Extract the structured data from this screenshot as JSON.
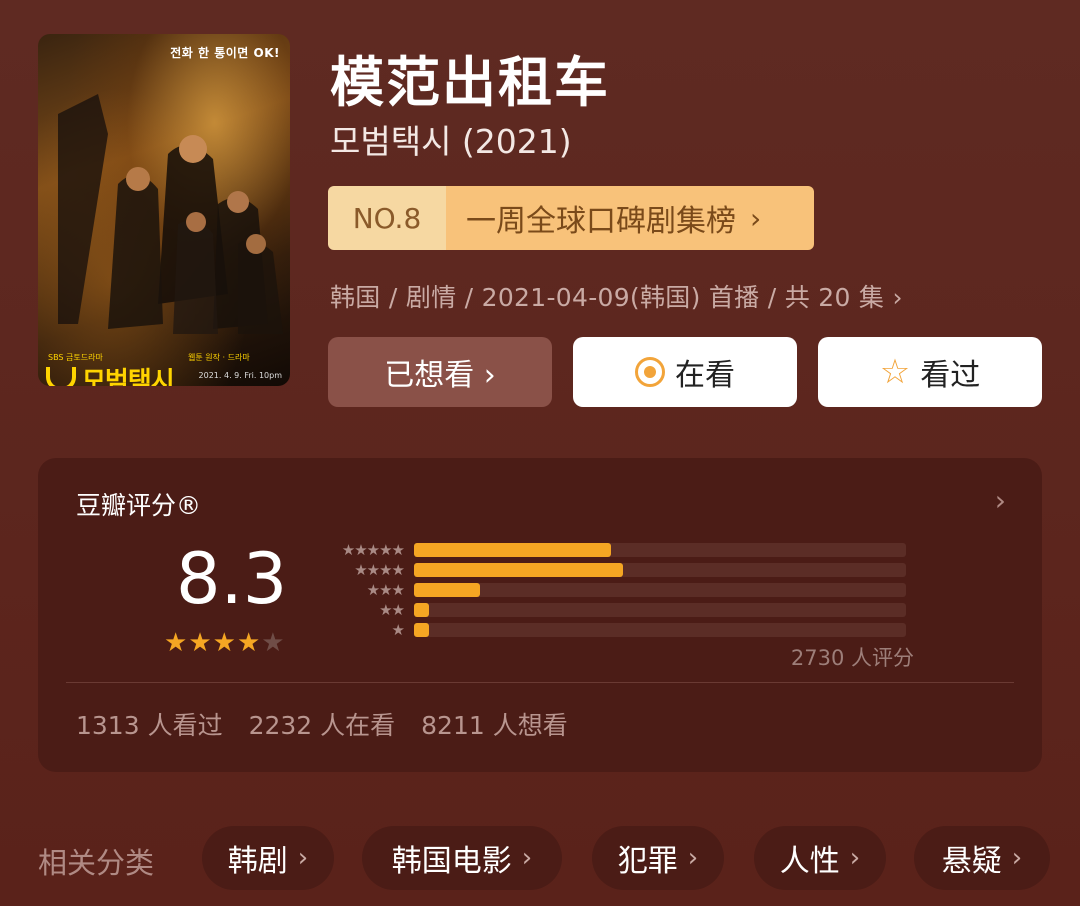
{
  "poster": {
    "tagline": "전화 한 통이면 OK!",
    "logo_text": "모범택시",
    "sub_top": "SBS 금토드라마",
    "sub_right": "웹툰 원작 · 드라마",
    "date": "2021. 4. 9. Fri. 10pm"
  },
  "title": "模范出租车",
  "subtitle": "모범택시 (2021)",
  "rank": {
    "no": "NO.8",
    "name": "一周全球口碑剧集榜",
    "chevron": "›"
  },
  "meta": "韩国 / 剧情 / 2021-04-09(韩国) 首播 / 共 20 集 ›",
  "buttons": {
    "wish": "已想看 ›",
    "watching": "在看",
    "watched": "看过"
  },
  "rating": {
    "title": "豆瓣评分®",
    "chevron": "›",
    "score": "8.3",
    "stars_filled": 4,
    "stars_total": 5,
    "distribution": [
      {
        "stars": "★★★★★",
        "fraction": 0.4
      },
      {
        "stars": "★★★★",
        "fraction": 0.425
      },
      {
        "stars": "★★★",
        "fraction": 0.135
      },
      {
        "stars": "★★",
        "fraction": 0.03
      },
      {
        "stars": "★",
        "fraction": 0.03
      }
    ],
    "raters": "2730 人评分",
    "stats": [
      "1313 人看过",
      "2232 人在看",
      "8211 人想看"
    ]
  },
  "related": {
    "label": "相关分类",
    "chips": [
      "韩剧",
      "韩国电影",
      "犯罪",
      "人性",
      "悬疑"
    ]
  },
  "colors": {
    "accent": "#f5a623",
    "background": "#5e241c",
    "card": "#4b1c16"
  }
}
